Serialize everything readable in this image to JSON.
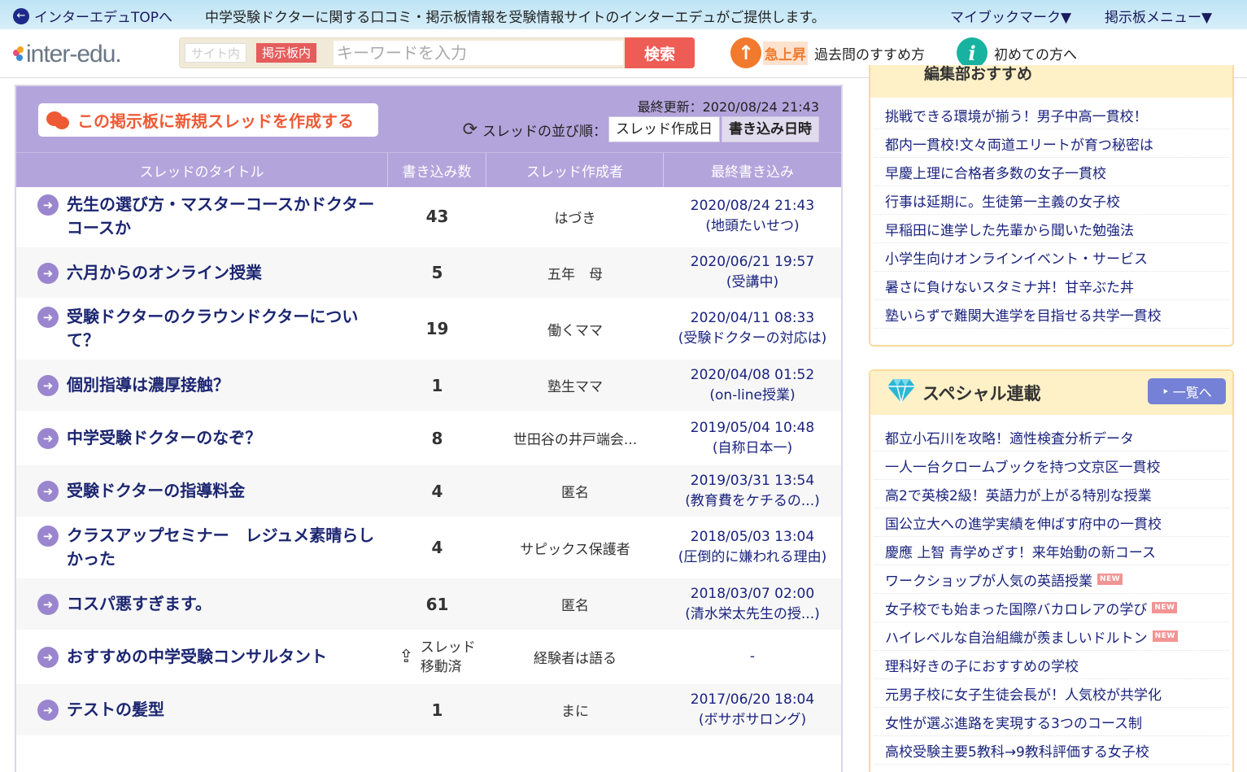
{
  "topbar": {
    "back_label": "インターエデュTOPへ",
    "description": "中学受験ドクターに関する口コミ・掲示板情報を受験情報サイトのインターエデュがご提供します。",
    "bookmark_label": "マイブックマーク▼",
    "board_menu_label": "掲示板メニュー▼"
  },
  "header": {
    "logo_text": "inter-edu.",
    "scope_site": "サイト内",
    "scope_board": "掲示板内",
    "search_placeholder": "キーワードを入力",
    "search_button": "検索",
    "rising_badge": "急上昇",
    "rising_link": "過去問のすすめ方",
    "beginner_link": "初めての方へ"
  },
  "board": {
    "new_thread_label": "この掲示板に新規スレッドを作成する",
    "last_updated": "最終更新：2020/08/24 21:43",
    "sort_label": "スレッドの並び順：",
    "sort_options": [
      "スレッド作成日",
      "書き込み日時"
    ],
    "active_sort": "書き込み日時",
    "columns": [
      "スレッドのタイトル",
      "書き込み数",
      "スレッド作成者",
      "最終書き込み"
    ],
    "threads": [
      {
        "title": "先生の選び方・マスターコースかドクターコースか",
        "count": "43",
        "author": "はづき",
        "last_date": "2020/08/24 21:43",
        "last_by": "(地頭たいせつ)"
      },
      {
        "title": "六月からのオンライン授業",
        "count": "5",
        "author": "五年　母",
        "last_date": "2020/06/21 19:57",
        "last_by": "(受講中)"
      },
      {
        "title": "受験ドクターのクラウンドクターについて？",
        "count": "19",
        "author": "働くママ",
        "last_date": "2020/04/11 08:33",
        "last_by": "(受験ドクターの対応は)"
      },
      {
        "title": "個別指導は濃厚接触？",
        "count": "1",
        "author": "塾生ママ",
        "last_date": "2020/04/08 01:52",
        "last_by": "(on-line授業)"
      },
      {
        "title": "中学受験ドクターのなぞ？",
        "count": "8",
        "author": "世田谷の井戸端会...",
        "last_date": "2019/05/04 10:48",
        "last_by": "(自称日本一)"
      },
      {
        "title": "受験ドクターの指導料金",
        "count": "4",
        "author": "匿名",
        "last_date": "2019/03/31 13:54",
        "last_by": "(教育費をケチるの...)"
      },
      {
        "title": "クラスアップセミナー　レジュメ素晴らしかった",
        "count": "4",
        "author": "サピックス保護者",
        "last_date": "2018/05/03 13:04",
        "last_by": "(圧倒的に嫌われる理由)"
      },
      {
        "title": "コスパ悪すぎます。",
        "count": "61",
        "author": "匿名",
        "last_date": "2018/03/07 02:00",
        "last_by": "(清水栄太先生の授...)"
      },
      {
        "title": "おすすめの中学受験コンサルタント",
        "count": "",
        "moved": "スレッド移動済",
        "moved_line1": "スレッド",
        "moved_line2": "移動済",
        "author": "経験者は語る",
        "last_date": "-",
        "last_by": ""
      },
      {
        "title": "テストの髪型",
        "count": "1",
        "author": "まに",
        "last_date": "2017/06/20 18:04",
        "last_by": "(ボサボサロング)"
      }
    ]
  },
  "sidebar": {
    "editor_caption": "編集部おすすめ",
    "editor_items": [
      "挑戦できる環境が揃う！男子中高一貫校！",
      "都内一貫校!文々両道エリートが育つ秘密は",
      "早慶上理に合格者多数の女子一貫校",
      "行事は延期に。生徒第一主義の女子校",
      "早稲田に進学した先輩から聞いた勉強法",
      "小学生向けオンラインイベント・サービス",
      "暑さに負けないスタミナ丼！甘辛ぶた丼",
      "塾いらずで難関大進学を目指せる共学一貫校"
    ],
    "special_title": "スペシャル連載",
    "list_button": "一覧へ",
    "new_badge": "NEW",
    "special_items": [
      {
        "text": "都立小石川を攻略！適性検査分析データ",
        "new": false
      },
      {
        "text": "一人一台クロームブックを持つ文京区一貫校",
        "new": false
      },
      {
        "text": "高2で英検2級！英語力が上がる特別な授業",
        "new": false
      },
      {
        "text": "国公立大への進学実績を伸ばす府中の一貫校",
        "new": false
      },
      {
        "text": "慶應 上智 青学めざす！来年始動の新コース",
        "new": false
      },
      {
        "text": "ワークショップが人気の英語授業",
        "new": true
      },
      {
        "text": "女子校でも始まった国際バカロレアの学び",
        "new": true
      },
      {
        "text": "ハイレベルな自治組織が羨ましいドルトン",
        "new": true
      },
      {
        "text": "理科好きの子におすすめの学校",
        "new": false
      },
      {
        "text": "元男子校に女子生徒会長が！人気校が共学化",
        "new": false
      },
      {
        "text": "女性が選ぶ進路を実現する3つのコース制",
        "new": false
      },
      {
        "text": "高校受験主要5教科→9教科評価する女子校",
        "new": false
      }
    ]
  }
}
